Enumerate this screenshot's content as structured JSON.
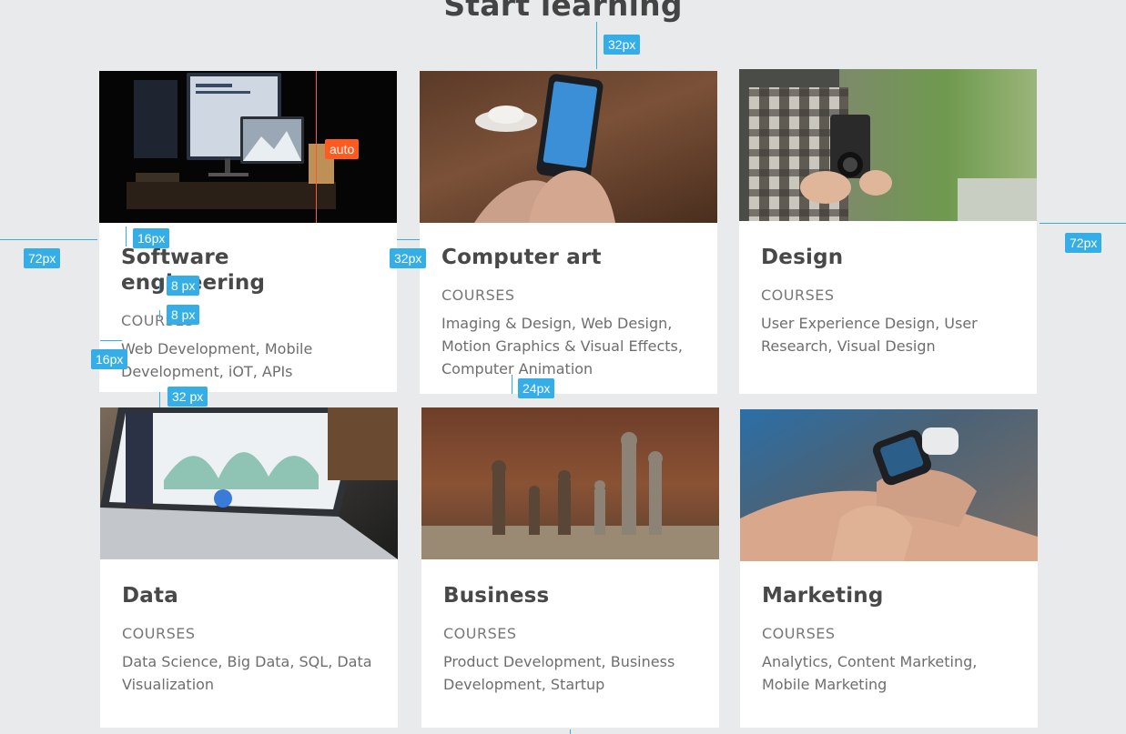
{
  "page": {
    "title": "Start learning"
  },
  "cards": [
    {
      "title": "Software engineering",
      "category": "COURSES",
      "description": "Web Development, Mobile Development, iOT, APIs"
    },
    {
      "title": "Computer art",
      "category": "COURSES",
      "description": "Imaging & Design, Web Design, Motion Graphics & Visual Effects, Computer Animation"
    },
    {
      "title": "Design",
      "category": "COURSES",
      "description": "User Experience Design, User Research, Visual Design"
    },
    {
      "title": "Data",
      "category": "COURSES",
      "description": "Data Science, Big Data, SQL, Data Visualization"
    },
    {
      "title": "Business",
      "category": "COURSES",
      "description": "Product Development, Business Development, Startup"
    },
    {
      "title": "Marketing",
      "category": "COURSES",
      "description": "Analytics, Content Marketing, Mobile Marketing"
    }
  ],
  "annotations": {
    "top_gap": "32px",
    "img_auto": "auto",
    "title_top_gap": "16px",
    "left_margin": "72px",
    "column_gap": "32px",
    "right_margin": "72px",
    "title_cat_gap": "8 px",
    "cat_desc_gap": "8 px",
    "side_padding": "16px",
    "row_gap": "32 px",
    "bottom_padding": "24px"
  },
  "colors": {
    "annotation": "#35aee7",
    "annotation_auto": "#ff5a1f",
    "background": "#e9eaec"
  }
}
